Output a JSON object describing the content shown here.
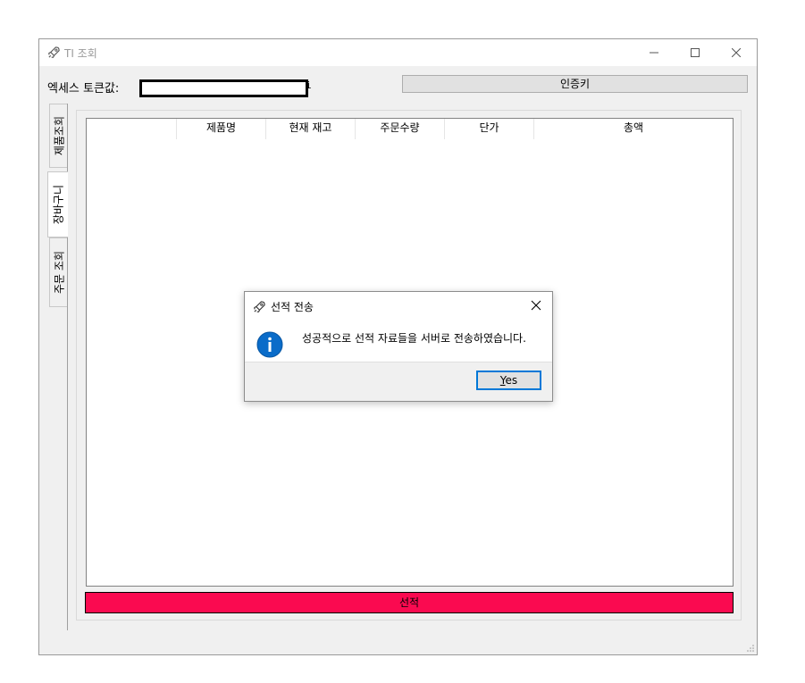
{
  "window": {
    "title": "TI 조회",
    "app_icon": "rocket-icon"
  },
  "token": {
    "label": "엑세스 토큰값:",
    "value_tail": "i"
  },
  "auth_button": "인증키",
  "tabs": [
    {
      "label": "제품조회",
      "active": false
    },
    {
      "label": "장바구니",
      "active": true
    },
    {
      "label": "주문 조회",
      "active": false
    }
  ],
  "table": {
    "columns": [
      "",
      "제품명",
      "현재 재고",
      "주문수량",
      "단가",
      "총액"
    ],
    "rows": []
  },
  "select_button": {
    "label": "선적",
    "color": "#fa0a50"
  },
  "dialog": {
    "title": "선적 전송",
    "message": "성공적으로 선적 자료들을 서버로 전송하였습니다.",
    "icon": "info-icon",
    "yes_label": "Yes"
  }
}
